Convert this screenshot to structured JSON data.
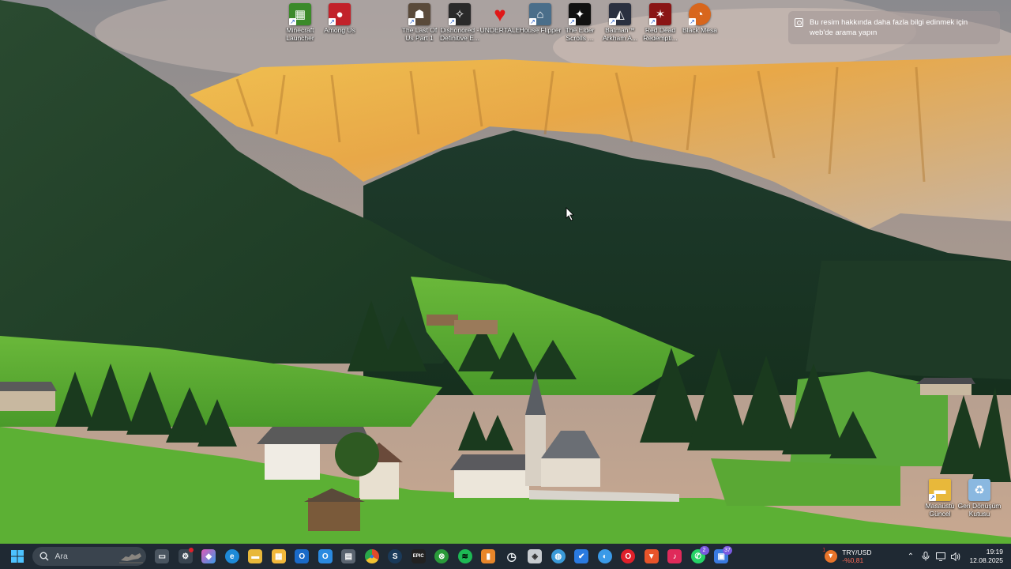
{
  "desktop": {
    "icons": [
      {
        "label": "Minecraft Launcher",
        "icon": "minecraft-icon",
        "color": "#3b8a2a"
      },
      {
        "label": "Among Us",
        "icon": "among-us-icon",
        "color": "#c2222a"
      },
      {
        "label": "The Last Of Us Part 1",
        "icon": "last-of-us-icon",
        "color": "#5a4a3a"
      },
      {
        "label": "Dishonored - Definitive E...",
        "icon": "dishonored-icon",
        "color": "#2a2a2a"
      },
      {
        "label": "UNDERTALE",
        "icon": "heart-icon",
        "color": "#e01818"
      },
      {
        "label": "House Flipper",
        "icon": "house-flipper-icon",
        "color": "#4a6e8a"
      },
      {
        "label": "The Elder Scrolls ...",
        "icon": "elder-scrolls-icon",
        "color": "#111111"
      },
      {
        "label": "Batman™ Arkham A...",
        "icon": "batman-icon",
        "color": "#2a3040"
      },
      {
        "label": "Red Dead Redempti...",
        "icon": "red-dead-icon",
        "color": "#8a1515"
      },
      {
        "label": "Black Mesa",
        "icon": "black-mesa-icon",
        "color": "#d8661c"
      },
      {
        "label": "Masaüstü Güncel",
        "icon": "folder-icon",
        "color": "#e8b83a"
      },
      {
        "label": "Geri Dönüşüm Kutusu",
        "icon": "recycle-bin-icon",
        "color": "#5a9ad8"
      }
    ]
  },
  "info_bubble": {
    "text": "Bu resim hakkında daha fazla bilgi edinmek için web'de arama yapın",
    "icon": "camera-search-icon"
  },
  "taskbar": {
    "search_placeholder": "Ara",
    "apps": [
      {
        "name": "task-view",
        "glyph": "▭",
        "color": "#4a5560"
      },
      {
        "name": "steam-helper",
        "glyph": "⚙",
        "color": "#3a4550",
        "badge": "",
        "badge_color": "#e0202a"
      },
      {
        "name": "copilot",
        "glyph": "◆",
        "color": "#7a5ae0"
      },
      {
        "name": "edge",
        "glyph": "e",
        "color": "#1e8ad8"
      },
      {
        "name": "file-explorer",
        "glyph": "▬",
        "color": "#e8b83a"
      },
      {
        "name": "microsoft-store",
        "glyph": "▦",
        "color": "#f2b83a"
      },
      {
        "name": "outlook",
        "glyph": "O",
        "color": "#1a6ac8"
      },
      {
        "name": "outlook-new",
        "glyph": "O",
        "color": "#2a8ae0"
      },
      {
        "name": "calculator",
        "glyph": "▤",
        "color": "#5a6470"
      },
      {
        "name": "chrome",
        "glyph": "◉",
        "color": "#e04a2a"
      },
      {
        "name": "steam",
        "glyph": "S",
        "color": "#1a3a5a"
      },
      {
        "name": "epic-games",
        "glyph": "EPIC",
        "color": "#222222"
      },
      {
        "name": "xbox",
        "glyph": "⊗",
        "color": "#2a9a3a"
      },
      {
        "name": "spotify",
        "glyph": "≋",
        "color": "#1db954"
      },
      {
        "name": "app-orange",
        "glyph": "▮",
        "color": "#e8862a"
      },
      {
        "name": "clock-app",
        "glyph": "◷",
        "color": "#e8ecef"
      },
      {
        "name": "app-shield",
        "glyph": "◈",
        "color": "#c8ccd0"
      },
      {
        "name": "globe-app",
        "glyph": "◍",
        "color": "#3a9ad8"
      },
      {
        "name": "todo",
        "glyph": "✔",
        "color": "#2a7ae0"
      },
      {
        "name": "app-blue-circle",
        "glyph": "◐",
        "color": "#3a9ae8"
      },
      {
        "name": "opera",
        "glyph": "O",
        "color": "#e0202a"
      },
      {
        "name": "brave",
        "glyph": "▼",
        "color": "#e8542a"
      },
      {
        "name": "tiktok",
        "glyph": "♪",
        "color": "#e02a5a"
      },
      {
        "name": "whatsapp",
        "glyph": "✆",
        "color": "#25d366",
        "badge": "2",
        "badge_color": "#7a5ae0"
      },
      {
        "name": "app-badge-37",
        "glyph": "▣",
        "color": "#3a7ae0",
        "badge": "37",
        "badge_color": "#7a5ae0"
      }
    ],
    "currency": {
      "pair": "TRY/USD",
      "change": "-%0,81",
      "badge": "1",
      "accent": "#e8742a"
    },
    "tray_icons": [
      "chevron-up-icon",
      "microphone-icon",
      "display-icon",
      "speaker-icon"
    ],
    "clock": {
      "time": "19:19",
      "date": "12.08.2025"
    }
  }
}
